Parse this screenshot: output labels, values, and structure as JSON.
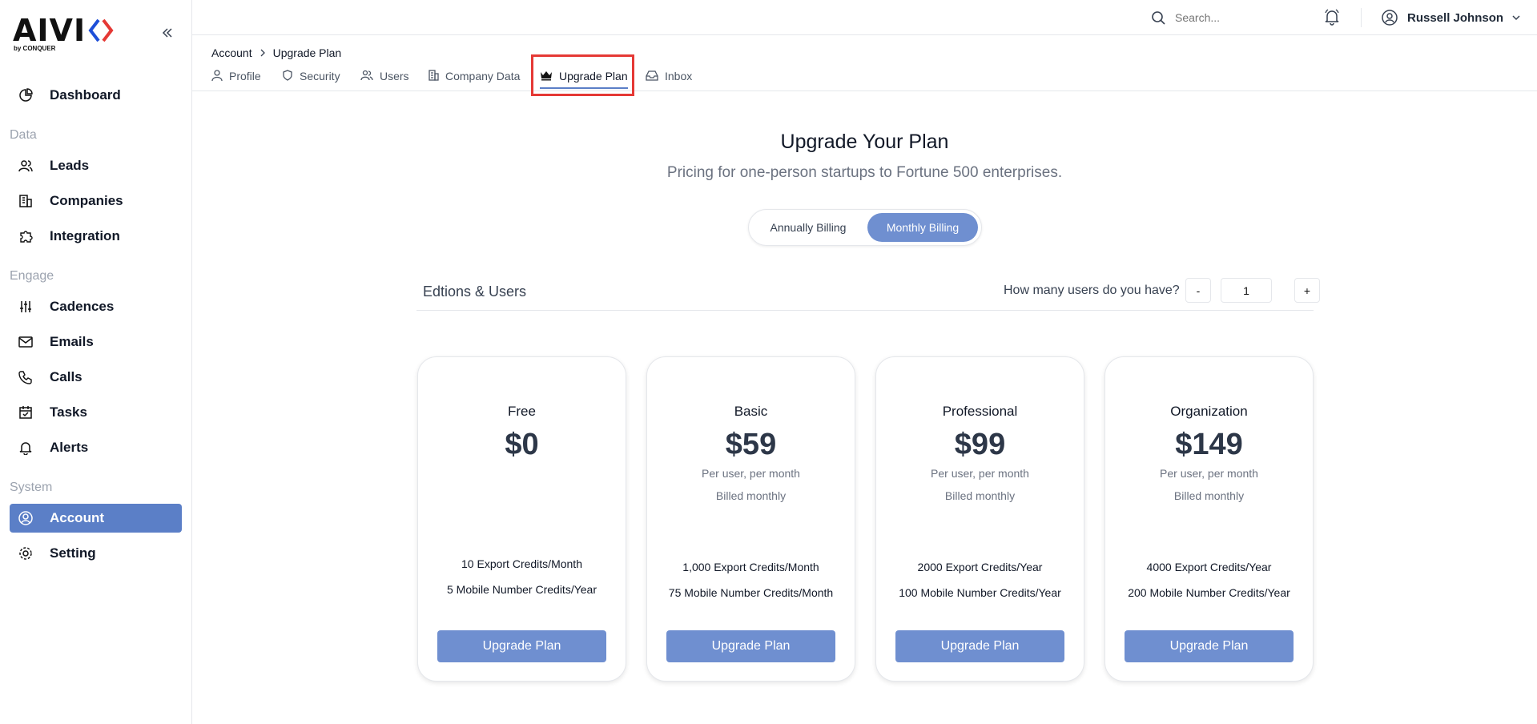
{
  "brand": {
    "logo_text": "AIVI",
    "logo_sub": "by CONQUER",
    "accent": "#5b7fc7",
    "button_color": "#6f8fd0"
  },
  "sidebar": {
    "sections": {
      "data": "Data",
      "engage": "Engage",
      "system": "System"
    },
    "items": [
      {
        "label": "Dashboard",
        "icon": "pie-chart-icon"
      },
      {
        "label": "Leads",
        "icon": "users-icon"
      },
      {
        "label": "Companies",
        "icon": "building-icon"
      },
      {
        "label": "Integration",
        "icon": "puzzle-icon"
      },
      {
        "label": "Cadences",
        "icon": "sliders-icon"
      },
      {
        "label": "Emails",
        "icon": "mail-icon"
      },
      {
        "label": "Calls",
        "icon": "phone-icon"
      },
      {
        "label": "Tasks",
        "icon": "calendar-check-icon"
      },
      {
        "label": "Alerts",
        "icon": "bell-icon"
      },
      {
        "label": "Account",
        "icon": "user-circle-icon",
        "active": true
      },
      {
        "label": "Setting",
        "icon": "gear-icon"
      }
    ]
  },
  "header": {
    "search_placeholder": "Search...",
    "user_name": "Russell Johnson"
  },
  "breadcrumb": {
    "root": "Account",
    "current": "Upgrade Plan"
  },
  "tabs": [
    {
      "label": "Profile",
      "icon": "user-icon"
    },
    {
      "label": "Security",
      "icon": "shield-icon"
    },
    {
      "label": "Users",
      "icon": "users-icon"
    },
    {
      "label": "Company Data",
      "icon": "building-icon"
    },
    {
      "label": "Upgrade Plan",
      "icon": "crown-icon",
      "active": true
    },
    {
      "label": "Inbox",
      "icon": "inbox-icon"
    }
  ],
  "main": {
    "title": "Upgrade Your Plan",
    "subtitle": "Pricing for one-person startups to Fortune 500 enterprises.",
    "billing": {
      "annual": "Annually Billing",
      "monthly": "Monthly Billing",
      "selected": "monthly"
    },
    "editions_label": "Edtions & Users",
    "users_question": "How many users do you have?",
    "users_count": "1",
    "minus": "-",
    "plus": "+"
  },
  "plans": [
    {
      "name": "Free",
      "price": "$0",
      "per": "",
      "billed": "",
      "feature1": "10 Export Credits/Month",
      "feature2": "5 Mobile Number Credits/Year",
      "button": "Upgrade Plan"
    },
    {
      "name": "Basic",
      "price": "$59",
      "per": "Per user, per month",
      "billed": "Billed monthly",
      "feature1": "1,000 Export Credits/Month",
      "feature2": "75 Mobile Number Credits/Month",
      "button": "Upgrade Plan"
    },
    {
      "name": "Professional",
      "price": "$99",
      "per": "Per user, per month",
      "billed": "Billed monthly",
      "feature1": "2000 Export Credits/Year",
      "feature2": "100 Mobile Number Credits/Year",
      "button": "Upgrade Plan"
    },
    {
      "name": "Organization",
      "price": "$149",
      "per": "Per user, per month",
      "billed": "Billed monthly",
      "feature1": "4000 Export Credits/Year",
      "feature2": "200 Mobile Number Credits/Year",
      "button": "Upgrade Plan"
    }
  ]
}
